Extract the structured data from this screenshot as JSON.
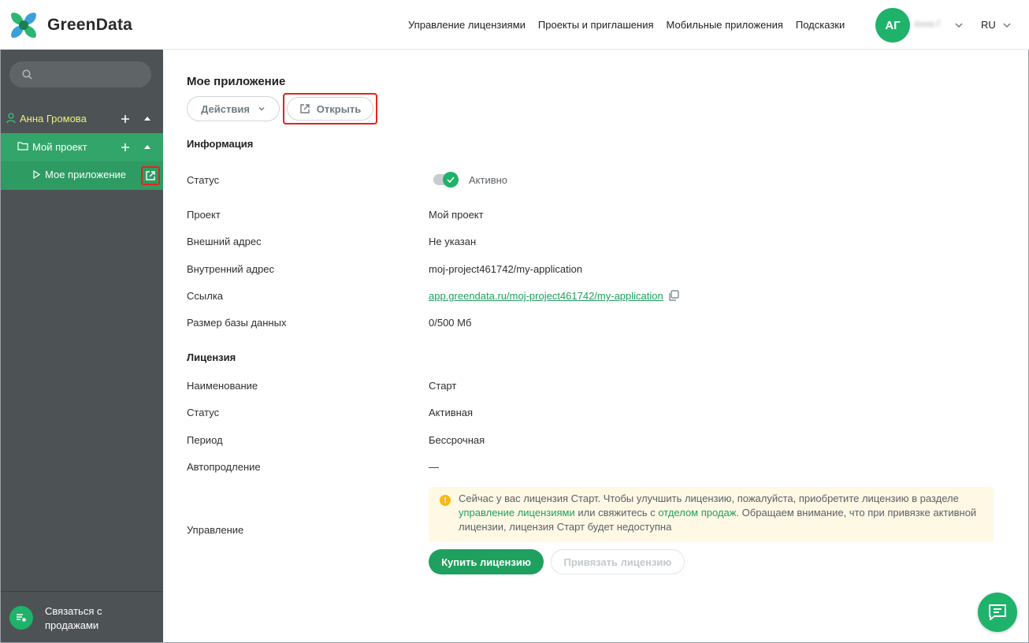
{
  "header": {
    "brand": "GreenData",
    "nav": [
      {
        "label": "Управление лицензиями"
      },
      {
        "label": "Проекты и приглашения"
      },
      {
        "label": "Мобильные приложения"
      },
      {
        "label": "Подсказки"
      }
    ],
    "avatar_initials": "АГ",
    "username": "Анна Г.",
    "lang": "RU"
  },
  "sidebar": {
    "search_placeholder": "",
    "user": "Анна Громова",
    "project": "Мой проект",
    "app": "Мое приложение",
    "contact_sales": "Связаться с продажами"
  },
  "main": {
    "title": "Мое приложение",
    "actions_label": "Действия",
    "open_label": "Открыть",
    "info": {
      "section": "Информация",
      "status_label": "Статус",
      "status_value": "Активно",
      "project_label": "Проект",
      "project_value": "Мой проект",
      "external_label": "Внешний адрес",
      "external_value": "Не указан",
      "internal_label": "Внутренний адрес",
      "internal_value": "moj-project461742/my-application",
      "link_label": "Ссылка",
      "link_value": "app.greendata.ru/moj-project461742/my-application",
      "dbsize_label": "Размер базы данных",
      "dbsize_value": "0/500 Мб"
    },
    "license": {
      "section": "Лицензия",
      "name_label": "Наименование",
      "name_value": "Старт",
      "status_label": "Статус",
      "status_value": "Активная",
      "period_label": "Период",
      "period_value": "Бессрочная",
      "autorenew_label": "Автопродление",
      "autorenew_value": "—",
      "manage_label": "Управление",
      "notice_1": "Сейчас у вас лицензия Старт. Чтобы улучшить лицензию, пожалуйста, приобретите лицензию в разделе ",
      "notice_link_1": "управление лицензиями",
      "notice_2": " или свяжитесь с ",
      "notice_link_2": "отделом продаж",
      "notice_3": ". Обращаем внимание, что при привязке активной лицензии, лицензия Старт будет недоступна",
      "buy_label": "Купить лицензию",
      "bind_label": "Привязать лицензию"
    }
  },
  "colors": {
    "accent": "#1fb26b",
    "sidebar_bg": "#4d5254",
    "selected_bg": "#32a56a",
    "highlight": "#e0251c"
  }
}
